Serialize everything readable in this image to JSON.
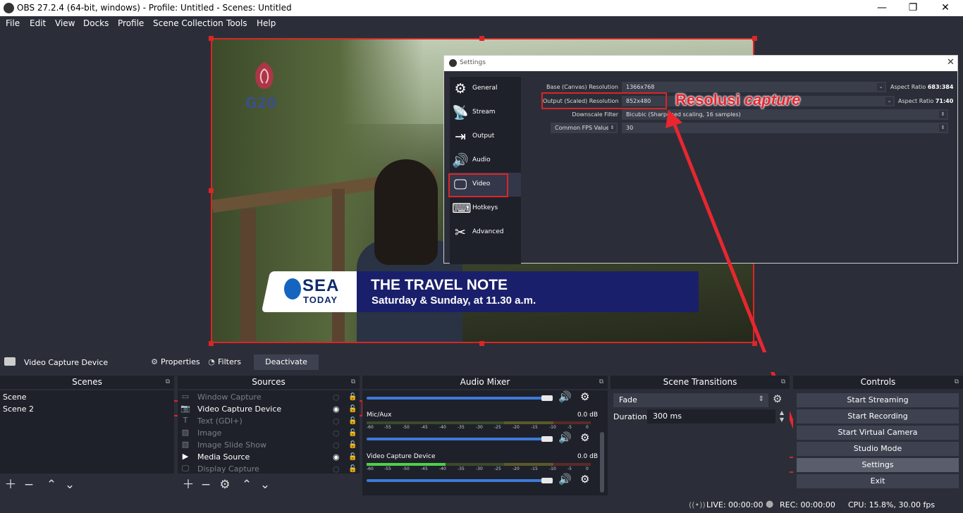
{
  "window": {
    "title": "OBS 27.2.4 (64-bit, windows) - Profile: Untitled - Scenes: Untitled",
    "minimize": "—",
    "maximize": "❐",
    "close": "✕"
  },
  "menu": [
    "File",
    "Edit",
    "View",
    "Docks",
    "Profile",
    "Scene Collection",
    "Tools",
    "Help"
  ],
  "preview": {
    "logo_text": "G20",
    "banner": {
      "brand_top": "SEA",
      "brand_bottom": "TODAY",
      "title": "THE TRAVEL NOTE",
      "subtitle": "Saturday & Sunday, at 11.30 a.m."
    }
  },
  "settings": {
    "title": "Settings",
    "close": "✕",
    "nav": [
      {
        "label": "General",
        "icon": "gear-icon"
      },
      {
        "label": "Stream",
        "icon": "antenna-icon"
      },
      {
        "label": "Output",
        "icon": "output-icon"
      },
      {
        "label": "Audio",
        "icon": "speaker-icon"
      },
      {
        "label": "Video",
        "icon": "monitor-icon"
      },
      {
        "label": "Hotkeys",
        "icon": "keyboard-icon"
      },
      {
        "label": "Advanced",
        "icon": "tools-icon"
      }
    ],
    "active_nav": "Video",
    "rows": {
      "base_label": "Base (Canvas) Resolution",
      "base_value": "1366x768",
      "base_aspect_label": "Aspect Ratio",
      "base_aspect_value": "683:384",
      "output_label": "Output (Scaled) Resolution",
      "output_value": "852x480",
      "output_aspect_label": "Aspect Ratio",
      "output_aspect_value": "71:40",
      "filter_label": "Downscale Filter",
      "filter_value": "Bicubic (Sharpened scaling, 16 samples)",
      "fps_label": "Common FPS Values",
      "fps_value": "30"
    }
  },
  "annotation": {
    "text_plain": "Resolusi",
    "text_italic": "capture"
  },
  "source_toolbar": {
    "source_name": "Video Capture Device",
    "properties": "Properties",
    "filters": "Filters",
    "deactivate": "Deactivate"
  },
  "scenes": {
    "header": "Scenes",
    "items": [
      "Scene",
      "Scene 2"
    ]
  },
  "sources": {
    "header": "Sources",
    "items": [
      {
        "label": "Window Capture",
        "icon": "window-icon",
        "visible": false
      },
      {
        "label": "Video Capture Device",
        "icon": "camera-icon",
        "visible": true
      },
      {
        "label": "Text (GDI+)",
        "icon": "text-icon",
        "visible": false
      },
      {
        "label": "Image",
        "icon": "image-icon",
        "visible": false
      },
      {
        "label": "Image Slide Show",
        "icon": "slideshow-icon",
        "visible": false
      },
      {
        "label": "Media Source",
        "icon": "play-icon",
        "visible": true
      },
      {
        "label": "Display Capture",
        "icon": "display-icon",
        "visible": false
      }
    ]
  },
  "audio_mixer": {
    "header": "Audio Mixer",
    "channels": [
      {
        "name": "Mic/Aux",
        "db": "0.0 dB"
      },
      {
        "name": "Video Capture Device",
        "db": "0.0 dB"
      }
    ],
    "scale": [
      "-60",
      "-55",
      "-50",
      "-45",
      "-40",
      "-35",
      "-30",
      "-25",
      "-20",
      "-15",
      "-10",
      "-5",
      "0"
    ]
  },
  "transitions": {
    "header": "Scene Transitions",
    "transition": "Fade",
    "duration_label": "Duration",
    "duration_value": "300 ms"
  },
  "controls": {
    "header": "Controls",
    "buttons": [
      "Start Streaming",
      "Start Recording",
      "Start Virtual Camera",
      "Studio Mode",
      "Settings",
      "Exit"
    ]
  },
  "status": {
    "live": "LIVE: 00:00:00",
    "rec": "REC: 00:00:00",
    "cpu": "CPU: 15.8%, 30.00 fps"
  },
  "colors": {
    "accent_red": "#d92626",
    "volume_blue": "#3d7ad9",
    "banner_blue": "#1a1f6b"
  }
}
